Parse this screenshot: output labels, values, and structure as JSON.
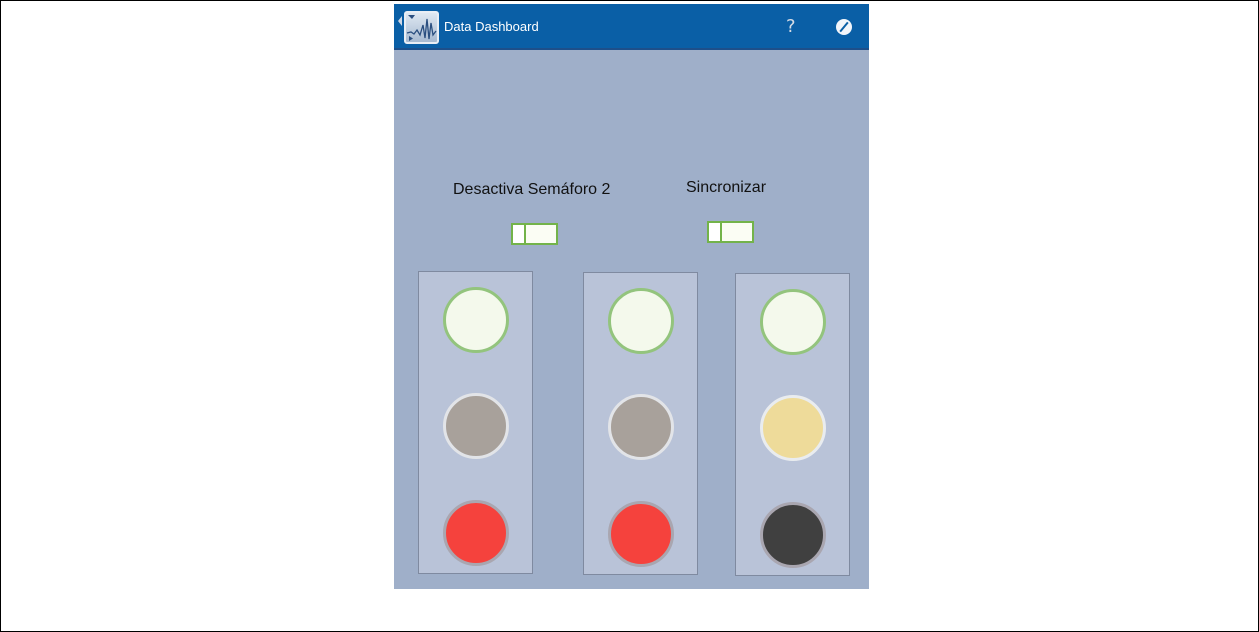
{
  "header": {
    "title": "Data Dashboard",
    "help_icon": "?",
    "icons": [
      "back-arrow-icon",
      "app-logo-icon",
      "help-icon",
      "edit-icon"
    ]
  },
  "controls": {
    "disable_label": "Desactiva Semáforo 2",
    "sync_label": "Sincronizar"
  },
  "colors": {
    "titlebar": "#0a5fa6",
    "background": "#9fafc9",
    "panel": "#b9c3d8",
    "toggle_border": "#73b34a",
    "light_off_white": "#f4f9ec",
    "light_off_white_border": "#93c47d",
    "light_gray": "#a8a19b",
    "light_yellow": "#eedb9a",
    "light_red": "#f5423d",
    "light_dark": "#404040"
  },
  "traffic_lights": [
    {
      "lights": [
        {
          "state": "off",
          "color": "#f4f9ec",
          "border": "#93c47d"
        },
        {
          "state": "off",
          "color": "#a8a19b",
          "border": "#e2e4e8"
        },
        {
          "state": "on",
          "color": "#f5423d",
          "border": "#a9a6b0"
        }
      ]
    },
    {
      "lights": [
        {
          "state": "off",
          "color": "#f4f9ec",
          "border": "#93c47d"
        },
        {
          "state": "off",
          "color": "#a8a19b",
          "border": "#e2e4e8"
        },
        {
          "state": "on",
          "color": "#f5423d",
          "border": "#a9a6b0"
        }
      ]
    },
    {
      "lights": [
        {
          "state": "off",
          "color": "#f4f9ec",
          "border": "#93c47d"
        },
        {
          "state": "on",
          "color": "#eedb9a",
          "border": "#e9ecef"
        },
        {
          "state": "off",
          "color": "#404040",
          "border": "#a9a6b0"
        }
      ]
    }
  ]
}
